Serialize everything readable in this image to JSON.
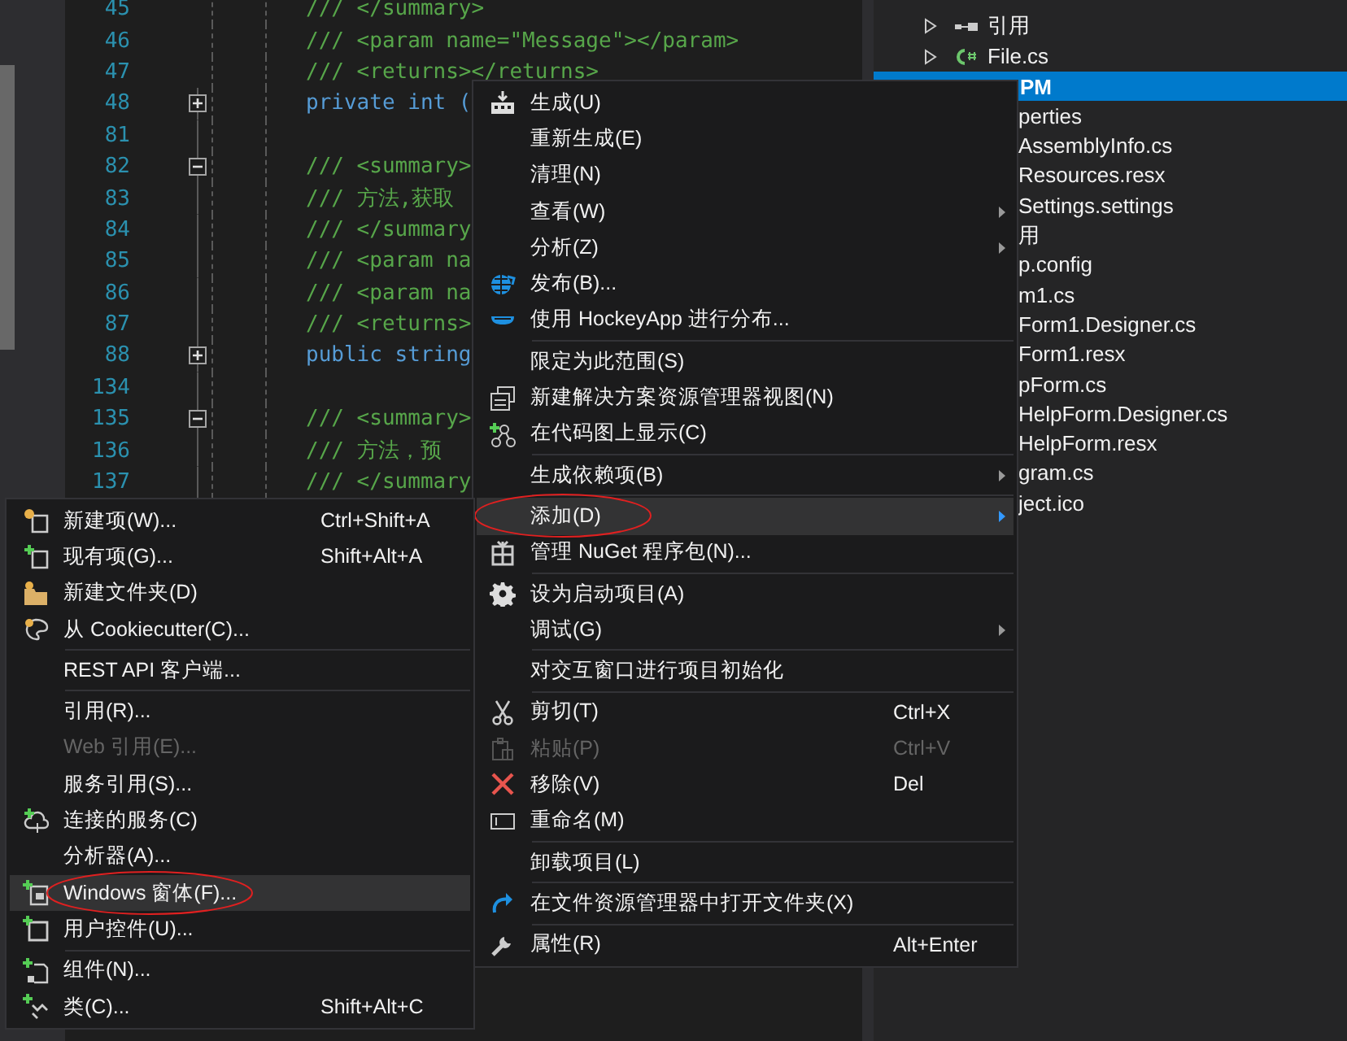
{
  "editor": {
    "lines": [
      {
        "number": "45",
        "text": "/// </summary>",
        "kind": "comment"
      },
      {
        "number": "46",
        "text": "/// <param name=\"Message\"></param>",
        "kind": "comment"
      },
      {
        "number": "47",
        "text": "/// <returns></returns>",
        "kind": "comment"
      },
      {
        "number": "48",
        "text": "private int (",
        "kind": "code",
        "collapsed": true
      },
      {
        "number": "81"
      },
      {
        "number": "82",
        "text": "/// <summary>",
        "kind": "comment",
        "collapsed": false
      },
      {
        "number": "83",
        "text": "/// 方法,获取",
        "kind": "comment"
      },
      {
        "number": "84",
        "text": "/// </summary",
        "kind": "comment"
      },
      {
        "number": "85",
        "text": "/// <param na",
        "kind": "comment"
      },
      {
        "number": "86",
        "text": "/// <param na",
        "kind": "comment"
      },
      {
        "number": "87",
        "text": "/// <returns>",
        "kind": "comment"
      },
      {
        "number": "88",
        "text": "public string",
        "kind": "code",
        "collapsed": true
      },
      {
        "number": "134"
      },
      {
        "number": "135",
        "text": "/// <summary>",
        "kind": "comment",
        "collapsed": false
      },
      {
        "number": "136",
        "text": "/// 方法，预",
        "kind": "comment"
      },
      {
        "number": "137",
        "text": "/// </summary",
        "kind": "comment"
      }
    ]
  },
  "solution_explorer": {
    "items": [
      {
        "label": "引用",
        "expanded": false,
        "selected": false
      },
      {
        "label": "File.cs",
        "expanded": false,
        "selected": false
      },
      {
        "label": "PM",
        "selected": true,
        "children": [
          {
            "label": "perties",
            "selected": false
          },
          {
            "label": "AssemblyInfo.cs",
            "selected": false
          },
          {
            "label": "Resources.resx",
            "selected": false
          },
          {
            "label": "Settings.settings",
            "selected": false
          },
          {
            "label": "用",
            "selected": false
          },
          {
            "label": "p.config",
            "selected": false
          },
          {
            "label": "m1.cs",
            "selected": false
          },
          {
            "label": "Form1.Designer.cs",
            "selected": false
          },
          {
            "label": "Form1.resx",
            "selected": false
          },
          {
            "label": "pForm.cs",
            "selected": false
          },
          {
            "label": "HelpForm.Designer.cs",
            "selected": false
          },
          {
            "label": "HelpForm.resx",
            "selected": false
          },
          {
            "label": "gram.cs",
            "selected": false
          },
          {
            "label": "ject.ico",
            "selected": false
          }
        ]
      }
    ]
  },
  "context_menu": {
    "items": [
      {
        "kind": "item",
        "label": "生成(U)",
        "selected": false,
        "disabled": false,
        "submenu": false,
        "circled": false
      },
      {
        "kind": "item",
        "label": "重新生成(E)",
        "selected": false,
        "disabled": false,
        "submenu": false,
        "circled": false
      },
      {
        "kind": "item",
        "label": "清理(N)",
        "selected": false,
        "disabled": false,
        "submenu": false,
        "circled": false
      },
      {
        "kind": "item",
        "label": "查看(W)",
        "selected": false,
        "disabled": false,
        "submenu": true,
        "circled": false
      },
      {
        "kind": "item",
        "label": "分析(Z)",
        "selected": false,
        "disabled": false,
        "submenu": true,
        "circled": false
      },
      {
        "kind": "item",
        "label": "发布(B)...",
        "selected": false,
        "disabled": false,
        "submenu": false,
        "circled": false
      },
      {
        "kind": "item",
        "label": "使用 HockeyApp 进行分布...",
        "selected": false,
        "disabled": false,
        "submenu": false,
        "circled": false
      },
      {
        "kind": "separator"
      },
      {
        "kind": "item",
        "label": "限定为此范围(S)",
        "selected": false,
        "disabled": false,
        "submenu": false,
        "circled": false
      },
      {
        "kind": "item",
        "label": "新建解决方案资源管理器视图(N)",
        "selected": false,
        "disabled": false,
        "submenu": false,
        "circled": false
      },
      {
        "kind": "item",
        "label": "在代码图上显示(C)",
        "selected": false,
        "disabled": false,
        "submenu": false,
        "circled": false
      },
      {
        "kind": "separator"
      },
      {
        "kind": "item",
        "label": "生成依赖项(B)",
        "selected": false,
        "disabled": false,
        "submenu": true,
        "circled": false
      },
      {
        "kind": "separator"
      },
      {
        "kind": "item",
        "label": "添加(D)",
        "selected": true,
        "disabled": false,
        "submenu": true,
        "circled": true
      },
      {
        "kind": "item",
        "label": "管理 NuGet 程序包(N)...",
        "selected": false,
        "disabled": false,
        "submenu": false,
        "circled": false
      },
      {
        "kind": "separator"
      },
      {
        "kind": "item",
        "label": "设为启动项目(A)",
        "selected": false,
        "disabled": false,
        "submenu": false,
        "circled": false
      },
      {
        "kind": "item",
        "label": "调试(G)",
        "selected": false,
        "disabled": false,
        "submenu": true,
        "circled": false
      },
      {
        "kind": "separator"
      },
      {
        "kind": "item",
        "label": "对交互窗口进行项目初始化",
        "selected": false,
        "disabled": false,
        "submenu": false,
        "circled": false
      },
      {
        "kind": "separator"
      },
      {
        "kind": "item",
        "label": "剪切(T)",
        "shortcut": "Ctrl+X",
        "selected": false,
        "disabled": false,
        "submenu": false,
        "circled": false
      },
      {
        "kind": "item",
        "label": "粘贴(P)",
        "shortcut": "Ctrl+V",
        "selected": false,
        "disabled": true,
        "submenu": false,
        "circled": false
      },
      {
        "kind": "item",
        "label": "移除(V)",
        "shortcut": "Del",
        "selected": false,
        "disabled": false,
        "submenu": false,
        "circled": false
      },
      {
        "kind": "item",
        "label": "重命名(M)",
        "selected": false,
        "disabled": false,
        "submenu": false,
        "circled": false
      },
      {
        "kind": "separator"
      },
      {
        "kind": "item",
        "label": "卸载项目(L)",
        "selected": false,
        "disabled": false,
        "submenu": false,
        "circled": false
      },
      {
        "kind": "separator"
      },
      {
        "kind": "item",
        "label": "在文件资源管理器中打开文件夹(X)",
        "selected": false,
        "disabled": false,
        "submenu": false,
        "circled": false
      },
      {
        "kind": "separator"
      },
      {
        "kind": "item",
        "label": "属性(R)",
        "shortcut": "Alt+Enter",
        "selected": false,
        "disabled": false,
        "submenu": false,
        "circled": false
      }
    ]
  },
  "add_submenu": {
    "items": [
      {
        "kind": "item",
        "label": "新建项(W)...",
        "shortcut": "Ctrl+Shift+A",
        "selected": false,
        "disabled": false,
        "submenu": false,
        "circled": false
      },
      {
        "kind": "item",
        "label": "现有项(G)...",
        "shortcut": "Shift+Alt+A",
        "selected": false,
        "disabled": false,
        "submenu": false,
        "circled": false
      },
      {
        "kind": "item",
        "label": "新建文件夹(D)",
        "selected": false,
        "disabled": false,
        "submenu": false,
        "circled": false
      },
      {
        "kind": "item",
        "label": "从 Cookiecutter(C)...",
        "selected": false,
        "disabled": false,
        "submenu": false,
        "circled": false
      },
      {
        "kind": "separator"
      },
      {
        "kind": "item",
        "label": "REST API 客户端...",
        "selected": false,
        "disabled": false,
        "submenu": false,
        "circled": false
      },
      {
        "kind": "separator"
      },
      {
        "kind": "item",
        "label": "引用(R)...",
        "selected": false,
        "disabled": false,
        "submenu": false,
        "circled": false
      },
      {
        "kind": "item",
        "label": "Web 引用(E)...",
        "selected": false,
        "disabled": true,
        "submenu": false,
        "circled": false
      },
      {
        "kind": "item",
        "label": "服务引用(S)...",
        "selected": false,
        "disabled": false,
        "submenu": false,
        "circled": false
      },
      {
        "kind": "item",
        "label": "连接的服务(C)",
        "selected": false,
        "disabled": false,
        "submenu": false,
        "circled": false
      },
      {
        "kind": "item",
        "label": "分析器(A)...",
        "selected": false,
        "disabled": false,
        "submenu": false,
        "circled": false
      },
      {
        "kind": "item",
        "label": "Windows 窗体(F)...",
        "selected": true,
        "disabled": false,
        "submenu": false,
        "circled": true
      },
      {
        "kind": "item",
        "label": "用户控件(U)...",
        "selected": false,
        "disabled": false,
        "submenu": false,
        "circled": false
      },
      {
        "kind": "separator"
      },
      {
        "kind": "item",
        "label": "组件(N)...",
        "selected": false,
        "disabled": false,
        "submenu": false,
        "circled": false
      },
      {
        "kind": "item",
        "label": "类(C)...",
        "shortcut": "Shift+Alt+C",
        "selected": false,
        "disabled": false,
        "submenu": false,
        "circled": false
      }
    ]
  }
}
